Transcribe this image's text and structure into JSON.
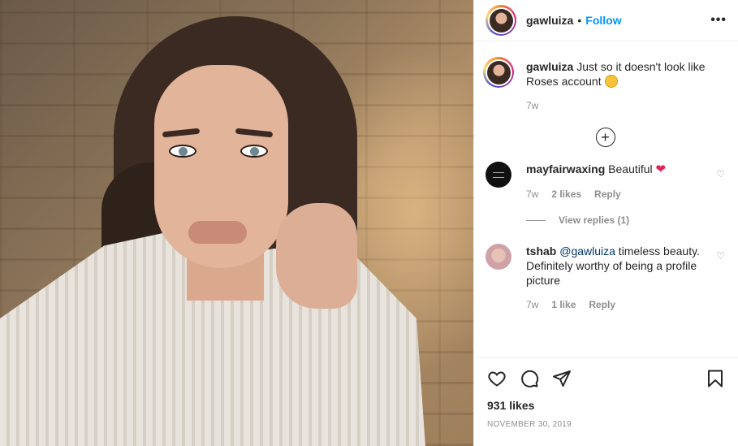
{
  "post": {
    "username": "gawluiza",
    "separator": "•",
    "follow_label": "Follow",
    "more_label": "•••"
  },
  "caption": {
    "username": "gawluiza",
    "text": "Just so it doesn't look like Roses account",
    "emoji": "upside-down-face-emoji",
    "time": "7w"
  },
  "load_more_icon": "plus-circle-icon",
  "comments": [
    {
      "username": "mayfairwaxing",
      "text": "Beautiful",
      "emoji": "red-heart-emoji",
      "time": "7w",
      "likes": "2 likes",
      "reply_label": "Reply",
      "view_replies": "View replies (1)"
    },
    {
      "username": "tshab",
      "mention": "@gawluiza",
      "text": " timeless beauty. Definitely worthy of being a profile picture",
      "time": "7w",
      "likes": "1 like",
      "reply_label": "Reply"
    }
  ],
  "actions": {
    "icons": [
      "heart-icon",
      "comment-icon",
      "share-icon",
      "bookmark-icon"
    ],
    "likes": "931 likes",
    "date": "NOVEMBER 30, 2019"
  },
  "colors": {
    "follow": "#0095f6",
    "text": "#262626",
    "muted": "#8e8e8e",
    "mention": "#00376b",
    "border": "#efefef"
  }
}
